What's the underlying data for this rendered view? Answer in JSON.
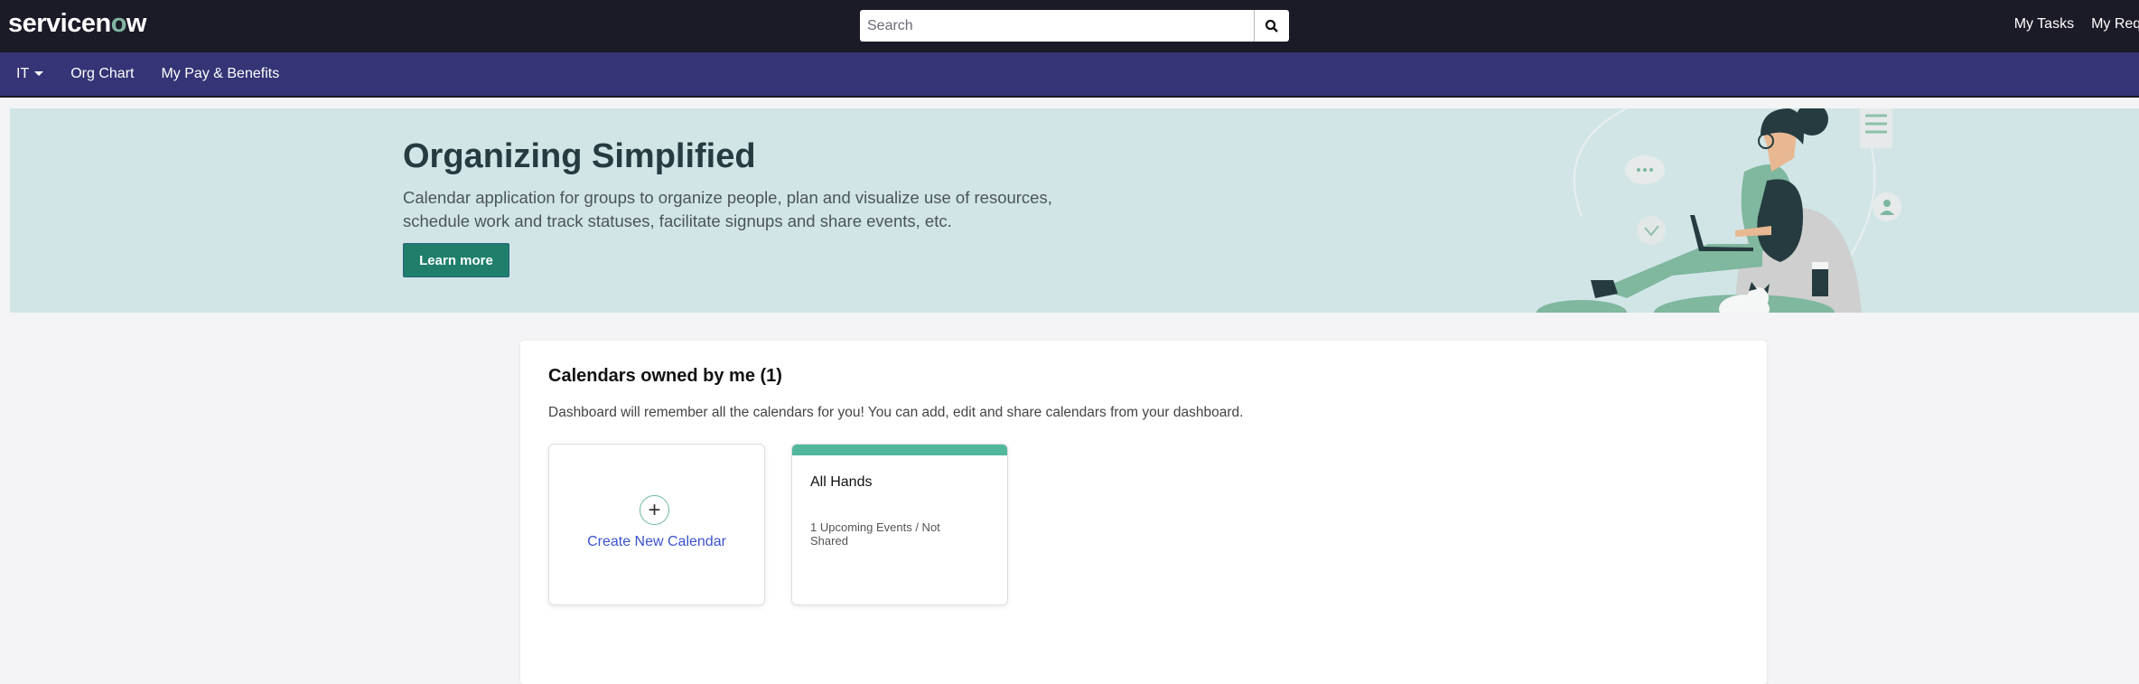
{
  "header": {
    "logo_text": "servicenow",
    "search_placeholder": "Search",
    "links": [
      "My Tasks",
      "My Reque"
    ]
  },
  "nav": {
    "items": [
      "IT",
      "Org Chart",
      "My Pay & Benefits"
    ]
  },
  "banner": {
    "title": "Organizing Simplified",
    "description": "Calendar application for groups to organize people, plan and visualize use of resources, schedule work and track statuses, facilitate signups and share events, etc.",
    "button": "Learn more"
  },
  "calendars": {
    "heading": "Calendars owned by me (1)",
    "description": "Dashboard will remember all the calendars for you! You can add, edit and share calendars from your dashboard.",
    "create_label": "Create New Calendar",
    "items": [
      {
        "title": "All Hands",
        "subtitle": "1 Upcoming Events / Not Shared",
        "color": "#52b89d"
      }
    ]
  }
}
